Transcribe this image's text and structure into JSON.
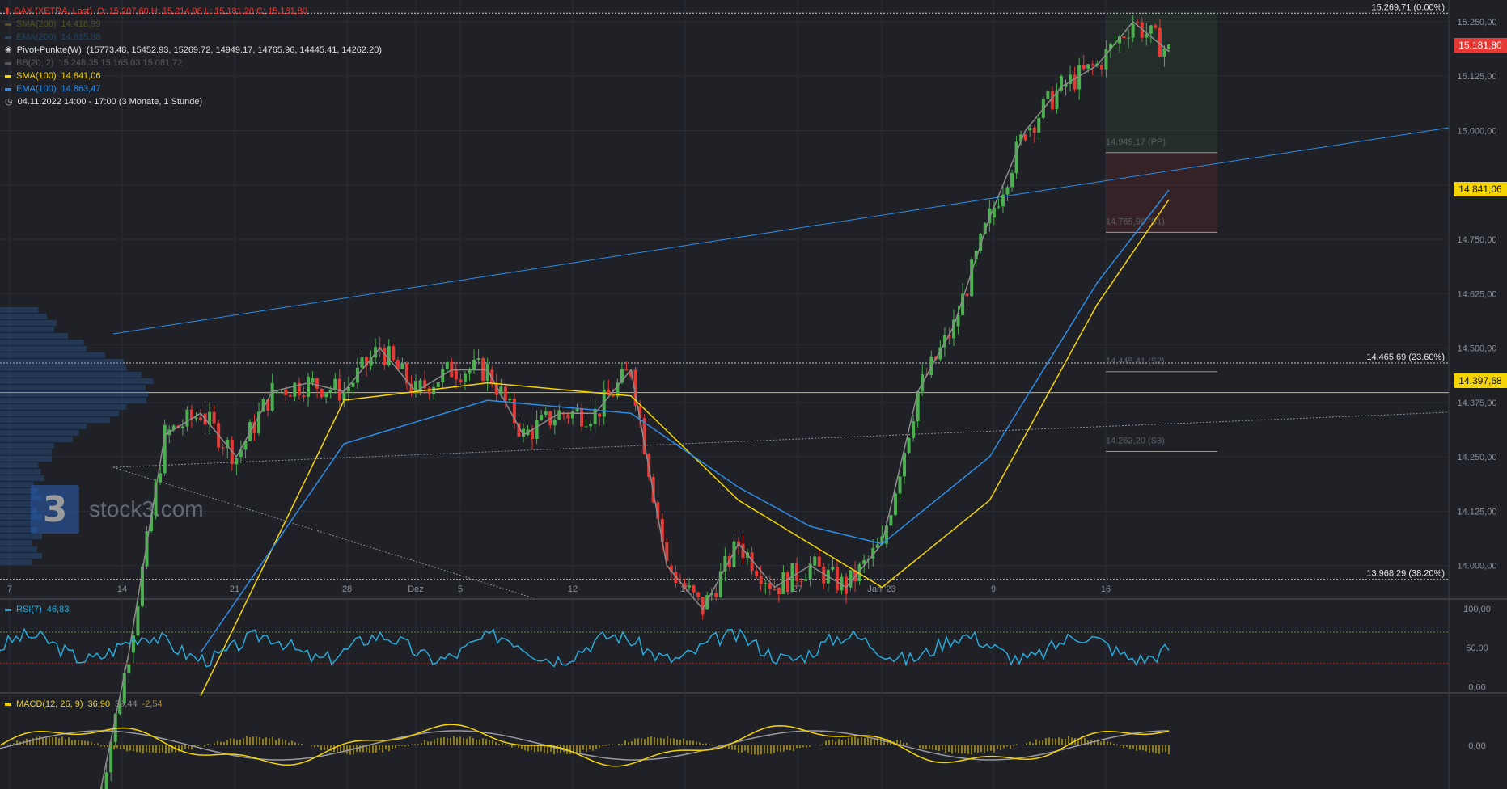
{
  "header": {
    "symbol": "DAX (XETRA, Last)",
    "ohlc": "O: 15.207,60  H: 15.214,98  L: 15.181,20  C: 15.181,80",
    "indicators": [
      {
        "name": "SMA(200)",
        "value": "14.418,99",
        "color": "#8a8f2a",
        "dim": true
      },
      {
        "name": "EMA(200)",
        "value": "14.615,38",
        "color": "#2f6fa0",
        "dim": true
      },
      {
        "name": "Pivot-Punkte(W)",
        "value": "(15773.48, 15452.93, 15269.72, 14949.17, 14765.96, 14445.41, 14262.20)",
        "color": "#ffffff",
        "dim": false
      },
      {
        "name": "BB(20, 2)",
        "value": "15.248,35  15.165,03  15.081,72",
        "color": "#9a9a9a",
        "dim": true
      },
      {
        "name": "SMA(100)",
        "value": "14.841,06",
        "color": "#f5d400",
        "dim": false
      },
      {
        "name": "EMA(100)",
        "value": "14.863,47",
        "color": "#2e8ce6",
        "dim": false
      }
    ],
    "timerange": "04.11.2022 14:00 - 17:00   (3 Monate, 1 Stunde)"
  },
  "logo": {
    "mark": "3",
    "text": "stock3.com"
  },
  "price_tags": {
    "last": "15.181,80",
    "sma100": "14.841,06",
    "line": "14.397,68"
  },
  "level_labels": {
    "top": "15.269,71 (0.00%)",
    "fib236": "14.465,69 (23.60%)",
    "fib382": "13.968,29 (38.20%)",
    "pp": "14.949,17 (PP)",
    "s1": "14.765,96 (S1)",
    "s2": "14.445,41 (S2)",
    "s3": "14.262,20 (S3)"
  },
  "rsi": {
    "label": "RSI(7)",
    "value": "46,83",
    "ticks": [
      "100,00",
      "50,00",
      "0,00"
    ]
  },
  "macd": {
    "label": "MACD(12, 26, 9)",
    "value": "36,90",
    "signal": "39,44",
    "hist": "-2,54",
    "tick": "0,00"
  },
  "colors": {
    "bg": "#1f2127",
    "up": "#4caf50",
    "down": "#e53935",
    "sma100": "#f5d400",
    "ema100": "#2e8ce6",
    "bb": "#8c8c8c",
    "rsi": "#2aa9d8",
    "macd": "#f5d400",
    "macd_signal": "#9a9aa0",
    "last_tag": "#e53935"
  },
  "chart_data": {
    "type": "line",
    "title": "DAX (XETRA, Last)",
    "xlabel": "",
    "ylabel": "",
    "ylim": [
      13925,
      15300
    ],
    "x_ticks": [
      "7",
      "14",
      "21",
      "28",
      "Dez",
      "5",
      "12",
      "19",
      "27",
      "Jan '23",
      "9",
      "16"
    ],
    "y_ticks": [
      "15.250,00",
      "15.125,00",
      "15.000,00",
      "14.875,00",
      "14.750,00",
      "14.625,00",
      "14.500,00",
      "14.375,00",
      "14.250,00",
      "14.125,00",
      "14.000,00"
    ],
    "close_series": [
      {
        "x": "07.11.",
        "y": 13400
      },
      {
        "x": "10.11.",
        "y": 13800
      },
      {
        "x": "14.11.",
        "y": 14300
      },
      {
        "x": "16.11.",
        "y": 14350
      },
      {
        "x": "18.11.",
        "y": 14250
      },
      {
        "x": "21.11.",
        "y": 14400
      },
      {
        "x": "23.11.",
        "y": 14420
      },
      {
        "x": "25.11.",
        "y": 14400
      },
      {
        "x": "28.11.",
        "y": 14500
      },
      {
        "x": "30.11.",
        "y": 14400
      },
      {
        "x": "Dez",
        "y": 14450
      },
      {
        "x": "05.12.",
        "y": 14450
      },
      {
        "x": "07.12.",
        "y": 14300
      },
      {
        "x": "09.12.",
        "y": 14350
      },
      {
        "x": "12.12.",
        "y": 14350
      },
      {
        "x": "14.12.",
        "y": 14450
      },
      {
        "x": "16.12.",
        "y": 14000
      },
      {
        "x": "19.12.",
        "y": 13900
      },
      {
        "x": "21.12.",
        "y": 14050
      },
      {
        "x": "23.12.",
        "y": 13950
      },
      {
        "x": "27.12.",
        "y": 14000
      },
      {
        "x": "29.12.",
        "y": 13950
      },
      {
        "x": "Jan '23",
        "y": 14050
      },
      {
        "x": "04.01.",
        "y": 14400
      },
      {
        "x": "06.01.",
        "y": 14550
      },
      {
        "x": "09.01.",
        "y": 14800
      },
      {
        "x": "11.01.",
        "y": 15000
      },
      {
        "x": "13.01.",
        "y": 15100
      },
      {
        "x": "16.01.",
        "y": 15150
      },
      {
        "x": "18.01.",
        "y": 15250
      },
      {
        "x": "19.01.",
        "y": 15181.8
      }
    ],
    "sma100": [
      {
        "x": "16.11.",
        "y": 13700
      },
      {
        "x": "25.11.",
        "y": 14380
      },
      {
        "x": "05.12.",
        "y": 14420
      },
      {
        "x": "14.12.",
        "y": 14390
      },
      {
        "x": "21.12.",
        "y": 14150
      },
      {
        "x": "27.12.",
        "y": 14050
      },
      {
        "x": "Jan '23",
        "y": 13950
      },
      {
        "x": "09.01.",
        "y": 14150
      },
      {
        "x": "16.01.",
        "y": 14600
      },
      {
        "x": "19.01.",
        "y": 14841.06
      }
    ],
    "ema100": [
      {
        "x": "16.11.",
        "y": 13800
      },
      {
        "x": "25.11.",
        "y": 14280
      },
      {
        "x": "05.12.",
        "y": 14380
      },
      {
        "x": "14.12.",
        "y": 14350
      },
      {
        "x": "21.12.",
        "y": 14180
      },
      {
        "x": "27.12.",
        "y": 14090
      },
      {
        "x": "Jan '23",
        "y": 14050
      },
      {
        "x": "09.01.",
        "y": 14250
      },
      {
        "x": "16.01.",
        "y": 14650
      },
      {
        "x": "19.01.",
        "y": 14863.47
      }
    ],
    "horizontal_levels": [
      {
        "label": "15.269,71 (0.00%)",
        "y": 15269.71
      },
      {
        "label": "14.465,69 (23.60%)",
        "y": 14465.69
      },
      {
        "label": "13.968,29 (38.20%)",
        "y": 13968.29
      },
      {
        "label": "14.397,68",
        "y": 14397.68
      }
    ],
    "pivots": [
      {
        "label": "14.949,17 (PP)",
        "y": 14949.17
      },
      {
        "label": "14.765,96 (S1)",
        "y": 14765.96
      },
      {
        "label": "14.445,41 (S2)",
        "y": 14445.41
      },
      {
        "label": "14.262,20 (S3)",
        "y": 14262.2
      }
    ],
    "last_price": 15181.8
  }
}
